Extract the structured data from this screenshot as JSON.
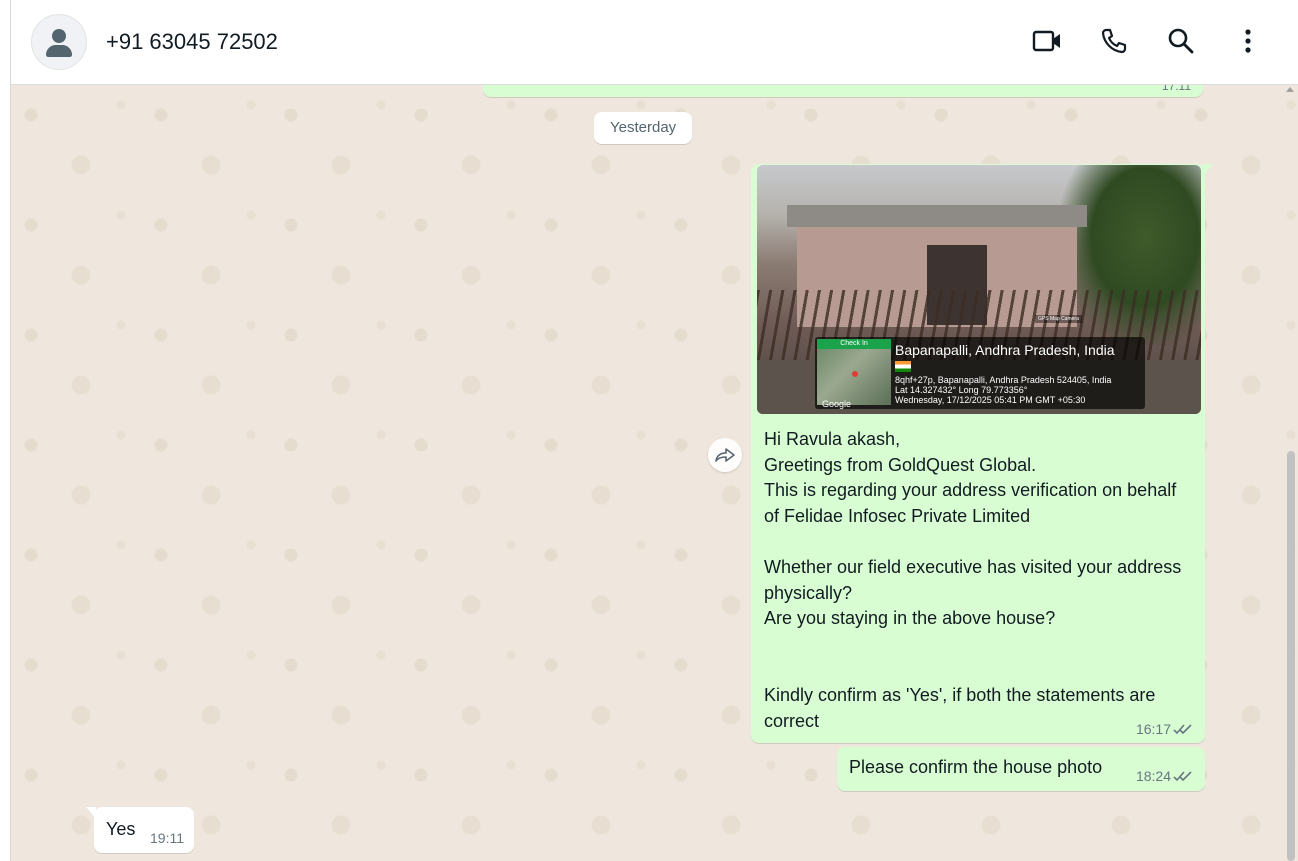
{
  "header": {
    "contact_name": "+91 63045 72502",
    "icons": [
      "video-call-icon",
      "voice-call-icon",
      "search-icon",
      "menu-icon"
    ]
  },
  "chat": {
    "prev_time_partial": "17:11",
    "date_chip": "Yesterday",
    "messages": [
      {
        "direction": "outgoing",
        "photo": {
          "check_in": "Check In",
          "watermark": "GPS Map Camera",
          "map_brand": "Google",
          "place": "Bapanapalli, Andhra Pradesh, India",
          "address": "8qhf+27p, Bapanapalli, Andhra Pradesh 524405, India",
          "coords": "Lat 14.327432° Long 79.773356°",
          "datetime": "Wednesday, 17/12/2025 05:41 PM GMT +05:30"
        },
        "text": "Hi Ravula akash,\nGreetings from GoldQuest Global.\nThis is regarding your address verification on behalf of Felidae Infosec Private Limited\n\nWhether our field executive has visited your address physically?\nAre you staying in the above house?\n\n\nKindly confirm as 'Yes', if both the statements are correct",
        "time": "16:17",
        "status": "read"
      },
      {
        "direction": "outgoing",
        "text": "Please confirm the house photo",
        "time": "18:24",
        "status": "read"
      },
      {
        "direction": "incoming",
        "text": "Yes",
        "time": "19:11"
      }
    ]
  },
  "colors": {
    "outgoing_bubble": "#d9fdd3",
    "incoming_bubble": "#ffffff",
    "chat_background": "#efe7dd",
    "read_ticks": "#667781"
  }
}
